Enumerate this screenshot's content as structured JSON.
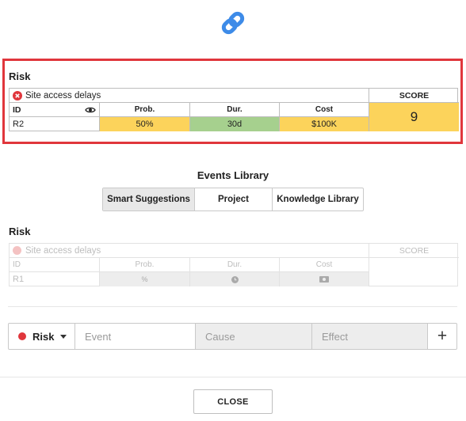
{
  "selected": {
    "section_label": "Risk",
    "name": "Site access delays",
    "id_header": "ID",
    "id_value": "R2",
    "score_header": "SCORE",
    "score_value": "9",
    "prob_header": "Prob.",
    "prob_value": "50%",
    "dur_header": "Dur.",
    "dur_value": "30d",
    "cost_header": "Cost",
    "cost_value": "$100K",
    "colors": {
      "probability": "#fcd35b",
      "duration": "#a6d08e",
      "cost": "#fcd35b",
      "score": "#fcd35b",
      "highlight": "#e0363c"
    }
  },
  "library": {
    "title": "Events Library",
    "tabs": [
      {
        "label": "Smart Suggestions",
        "active": true
      },
      {
        "label": "Project",
        "active": false
      },
      {
        "label": "Knowledge Library",
        "active": false
      }
    ]
  },
  "suggestion": {
    "section_label": "Risk",
    "name": "Site access delays",
    "id_header": "ID",
    "id_value": "R1",
    "score_header": "SCORE",
    "prob_header": "Prob.",
    "dur_header": "Dur.",
    "cost_header": "Cost",
    "prob_icon": "%",
    "dur_icon": "clock-icon",
    "cost_icon": "money-icon"
  },
  "new_event": {
    "type_label": "Risk",
    "type_color": "#e0363c",
    "event_placeholder": "Event",
    "cause_placeholder": "Cause",
    "effect_placeholder": "Effect",
    "add_symbol": "+"
  },
  "footer": {
    "close_label": "CLOSE"
  }
}
